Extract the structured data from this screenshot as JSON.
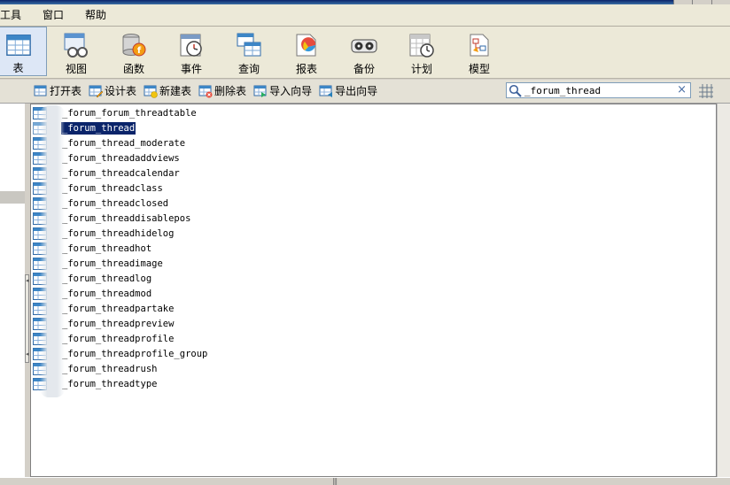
{
  "menu": [
    "工具",
    "窗口",
    "帮助"
  ],
  "big_toolbar": [
    {
      "label": "表",
      "icon": "table-icon",
      "active": true
    },
    {
      "label": "视图",
      "icon": "view-icon"
    },
    {
      "label": "函数",
      "icon": "function-icon"
    },
    {
      "label": "事件",
      "icon": "event-icon"
    },
    {
      "label": "查询",
      "icon": "query-icon"
    },
    {
      "label": "报表",
      "icon": "report-icon"
    },
    {
      "label": "备份",
      "icon": "backup-icon"
    },
    {
      "label": "计划",
      "icon": "schedule-icon"
    },
    {
      "label": "模型",
      "icon": "model-icon"
    }
  ],
  "sub_toolbar": [
    {
      "label": "打开表",
      "icon": "open-table-icon"
    },
    {
      "label": "设计表",
      "icon": "design-table-icon"
    },
    {
      "label": "新建表",
      "icon": "new-table-icon"
    },
    {
      "label": "删除表",
      "icon": "delete-table-icon"
    },
    {
      "label": "导入向导",
      "icon": "import-wizard-icon"
    },
    {
      "label": "导出向导",
      "icon": "export-wizard-icon"
    }
  ],
  "search": {
    "value": "_forum_thread",
    "clear": "×"
  },
  "tables": [
    "_forum_forum_threadtable",
    "_forum_thread",
    "_forum_thread_moderate",
    "_forum_threadaddviews",
    "_forum_threadcalendar",
    "_forum_threadclass",
    "_forum_threadclosed",
    "_forum_threaddisablepos",
    "_forum_threadhidelog",
    "_forum_threadhot",
    "_forum_threadimage",
    "_forum_threadlog",
    "_forum_threadmod",
    "_forum_threadpartake",
    "_forum_threadpreview",
    "_forum_threadprofile",
    "_forum_threadprofile_group",
    "_forum_threadrush",
    "_forum_threadtype"
  ],
  "selected_index": 1,
  "status": {
    "grip": "|||"
  }
}
